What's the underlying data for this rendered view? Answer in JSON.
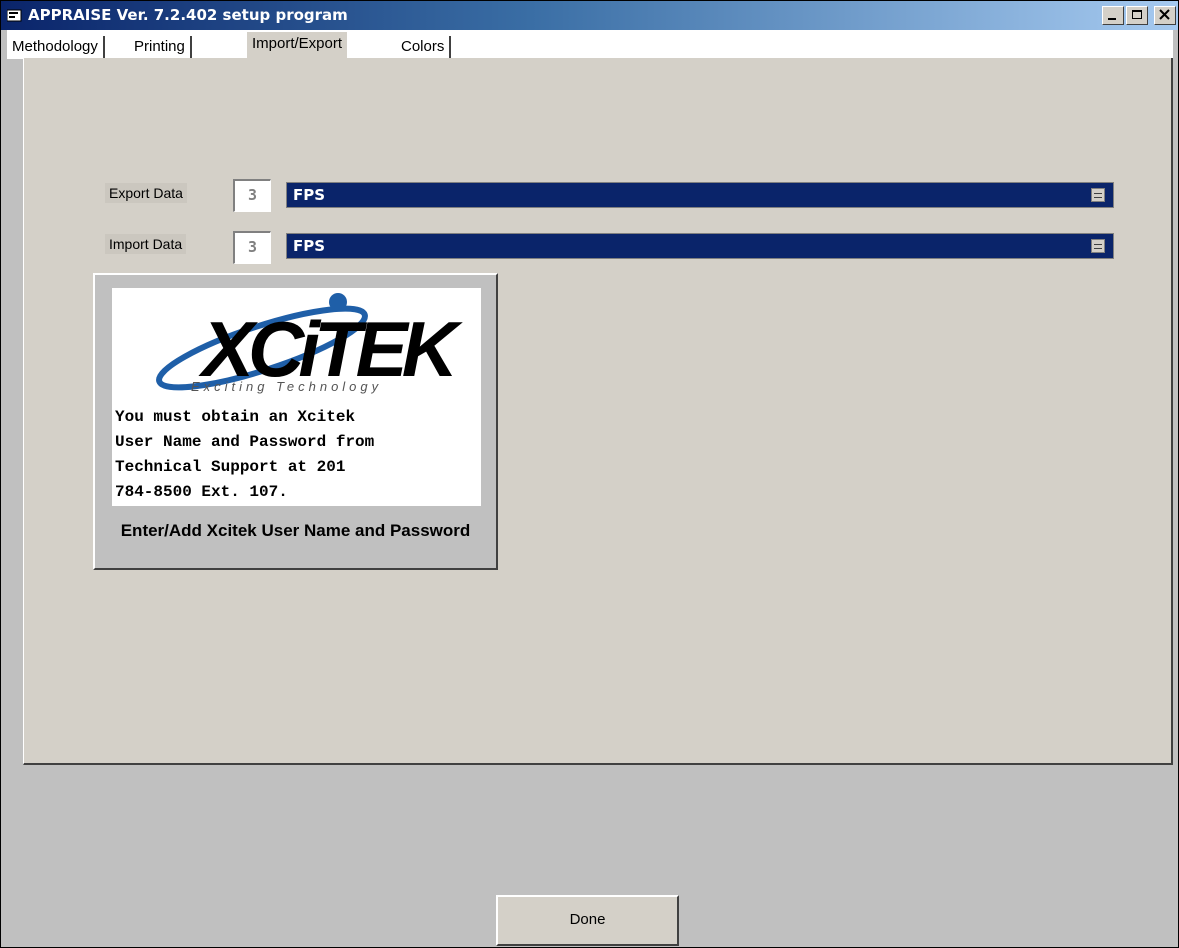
{
  "window": {
    "title": "APPRAISE Ver. 7.2.402 setup program"
  },
  "tabs": [
    {
      "label": "Methodology",
      "active": false
    },
    {
      "label": "Printing",
      "active": false
    },
    {
      "label": "Import/Export",
      "active": true
    },
    {
      "label": "Colors",
      "active": false
    }
  ],
  "export": {
    "label": "Export Data",
    "number": "3",
    "value": "FPS"
  },
  "import": {
    "label": "Import Data",
    "number": "3",
    "value": "FPS"
  },
  "xcitek": {
    "logo_text": "XCiTEK",
    "tagline": "Exciting Technology",
    "message": "You must obtain an Xcitek\nUser Name and Password from\nTechnical Support at 201\n784-8500 Ext. 107.",
    "button_label": "Enter/Add Xcitek User Name and Password"
  },
  "done_label": "Done",
  "colors": {
    "selection": "#0a246a",
    "face": "#d4d0c8",
    "logo_blue": "#1f5fa8"
  }
}
